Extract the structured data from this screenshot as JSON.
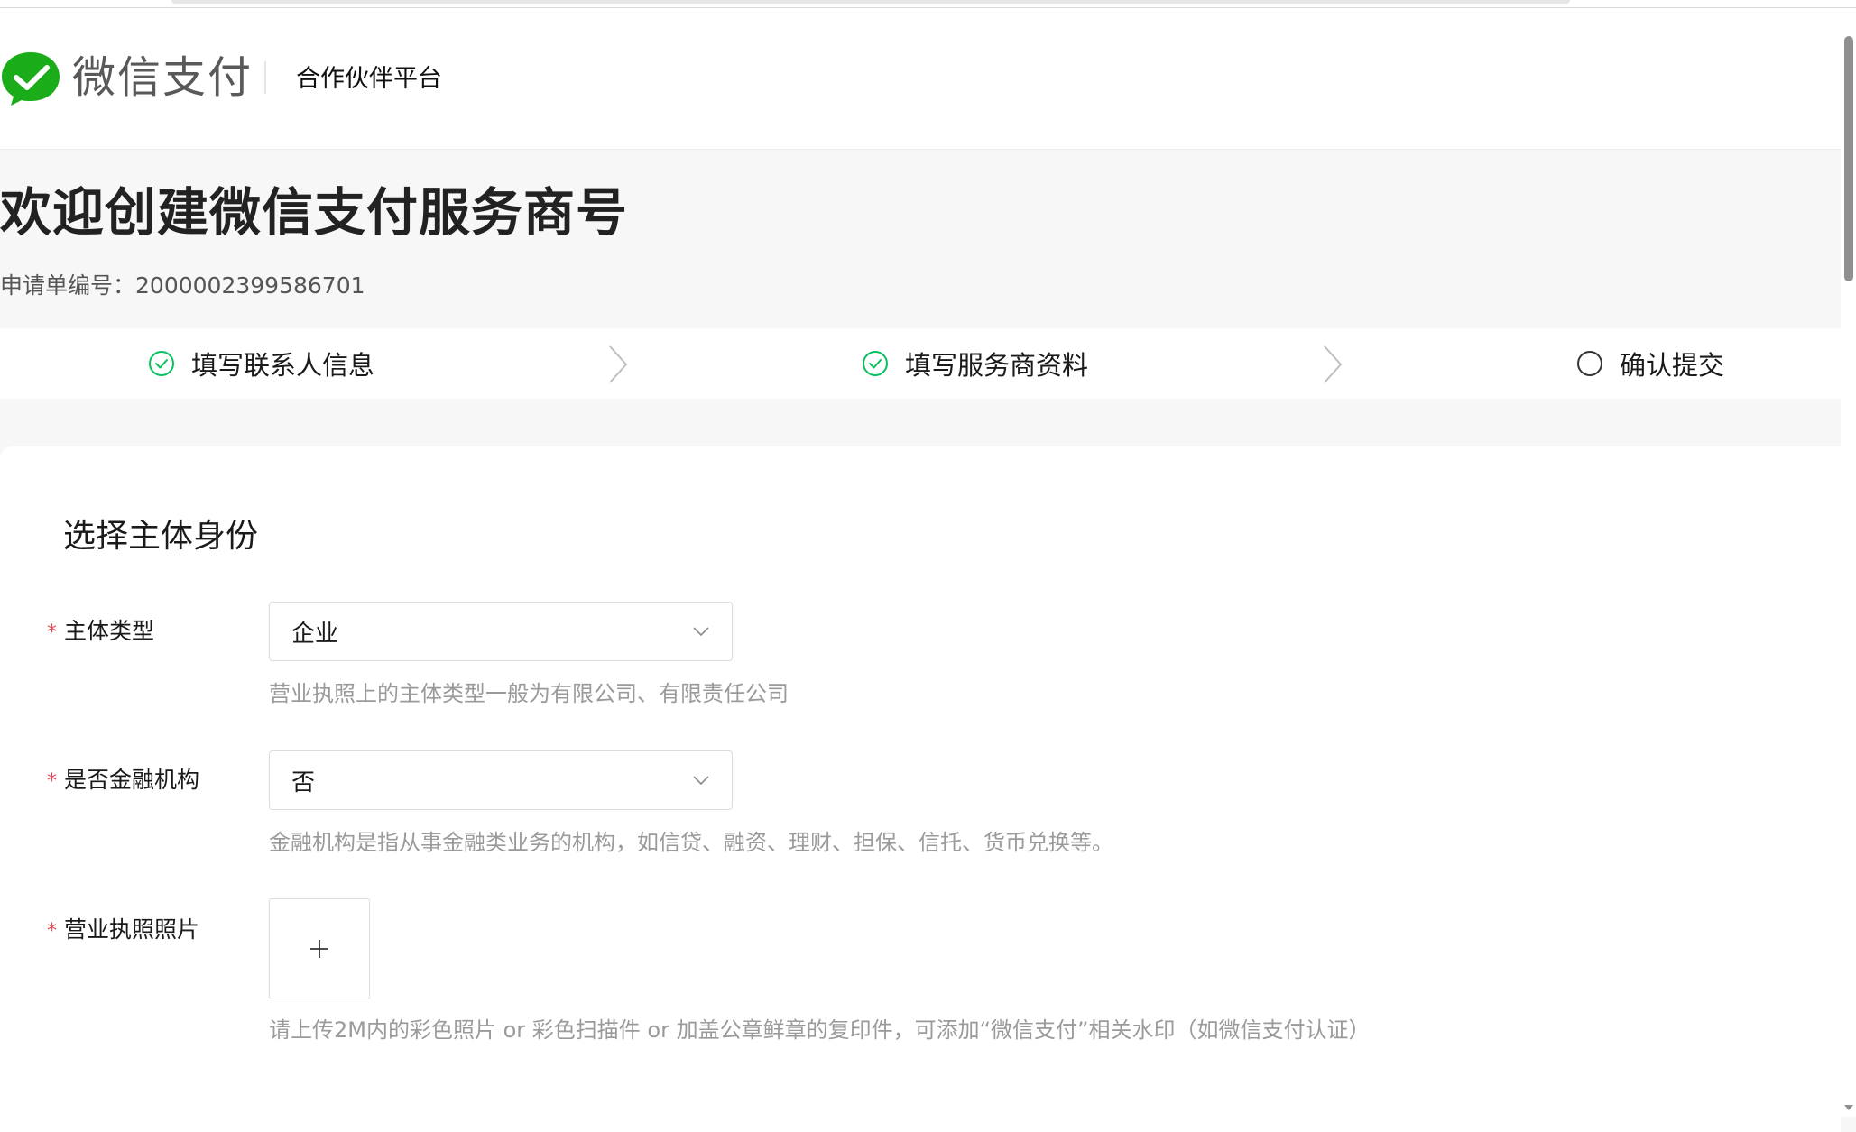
{
  "header": {
    "logo_text": "微信支付",
    "platform": "合作伙伴平台"
  },
  "title": "欢迎创建微信支付服务商号",
  "application": {
    "label": "申请单编号：",
    "number": "2000002399586701"
  },
  "steps": [
    {
      "label": "填写联系人信息",
      "status": "done"
    },
    {
      "label": "填写服务商资料",
      "status": "done"
    },
    {
      "label": "确认提交",
      "status": "pending"
    }
  ],
  "form": {
    "section_title": "选择主体身份",
    "required_mark": "*",
    "entity_type": {
      "label": "主体类型",
      "value": "企业",
      "hint": "营业执照上的主体类型一般为有限公司、有限责任公司"
    },
    "financial_institution": {
      "label": "是否金融机构",
      "value": "否",
      "hint": "金融机构是指从事金融类业务的机构，如信贷、融资、理财、担保、信托、货币兑换等。"
    },
    "business_license": {
      "label": "营业执照照片",
      "upload_symbol": "+",
      "hint": "请上传2M内的彩色照片 or 彩色扫描件 or 加盖公章鲜章的复印件，可添加“微信支付”相关水印（如微信支付认证）"
    }
  },
  "colors": {
    "brand_green": "#1aad19",
    "step_done": "#07c160",
    "required": "#e34d59",
    "hint": "#9a9a9a"
  },
  "icons": {
    "logo": "wechat-pay-check-bubble",
    "step_done": "check-circle-icon",
    "step_pending": "empty-circle-icon",
    "step_separator": "chevron-right-icon",
    "select_arrow": "chevron-down-icon",
    "upload": "plus-icon"
  }
}
